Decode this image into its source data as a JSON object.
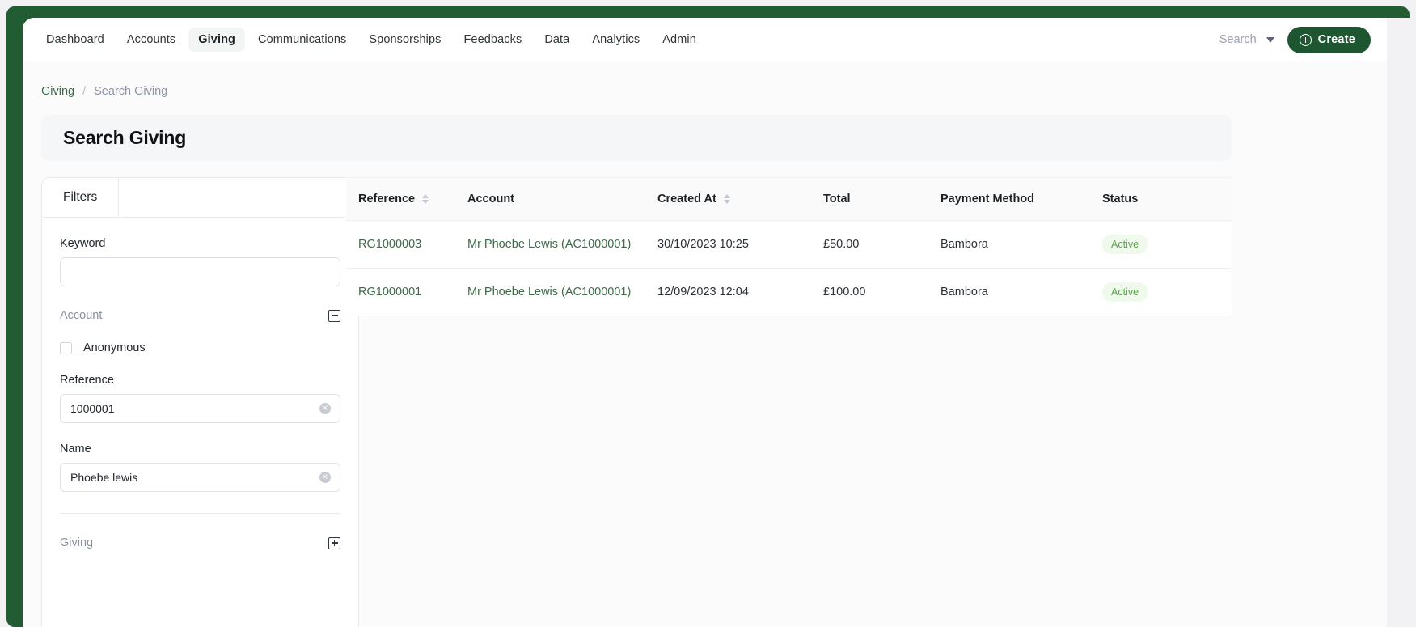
{
  "brand": {
    "green": "#1e5631",
    "rail": "#225c33",
    "link_green": "#3d6b49"
  },
  "navbar": {
    "items": [
      {
        "label": "Dashboard",
        "active": false
      },
      {
        "label": "Accounts",
        "active": false
      },
      {
        "label": "Giving",
        "active": true
      },
      {
        "label": "Communications",
        "active": false
      },
      {
        "label": "Sponsorships",
        "active": false
      },
      {
        "label": "Feedbacks",
        "active": false
      },
      {
        "label": "Data",
        "active": false
      },
      {
        "label": "Analytics",
        "active": false
      },
      {
        "label": "Admin",
        "active": false
      }
    ],
    "search_label": "Search",
    "search_icon": "chevron-down-icon",
    "create_label": "Create",
    "create_icon": "plus-circle-icon"
  },
  "breadcrumb": {
    "parent": "Giving",
    "separator": "/",
    "current": "Search Giving"
  },
  "page": {
    "title": "Search Giving"
  },
  "filters": {
    "tab_label": "Filters",
    "collapse_icon": "«",
    "keyword": {
      "label": "Keyword",
      "value": "",
      "placeholder": ""
    },
    "account_section": {
      "title": "Account",
      "toggle_icon": "minus-square-icon"
    },
    "anonymous": {
      "label": "Anonymous",
      "checked": false
    },
    "reference": {
      "label": "Reference",
      "value": "1000001",
      "clear_icon": "×"
    },
    "name": {
      "label": "Name",
      "value": "Phoebe lewis",
      "clear_icon": "×"
    },
    "giving_section": {
      "title": "Giving",
      "toggle_icon": "plus-square-icon"
    }
  },
  "results": {
    "columns": [
      {
        "label": "Reference",
        "sortable": true
      },
      {
        "label": "Account",
        "sortable": false
      },
      {
        "label": "Created At",
        "sortable": true
      },
      {
        "label": "Total",
        "sortable": false
      },
      {
        "label": "Payment Method",
        "sortable": false
      },
      {
        "label": "Status",
        "sortable": false
      }
    ],
    "rows": [
      {
        "reference": "RG1000003",
        "account": "Mr Phoebe Lewis (AC1000001)",
        "created_at": "30/10/2023 10:25",
        "total": "£50.00",
        "payment_method": "Bambora",
        "status": "Active"
      },
      {
        "reference": "RG1000001",
        "account": "Mr Phoebe Lewis (AC1000001)",
        "created_at": "12/09/2023 12:04",
        "total": "£100.00",
        "payment_method": "Bambora",
        "status": "Active"
      }
    ]
  }
}
